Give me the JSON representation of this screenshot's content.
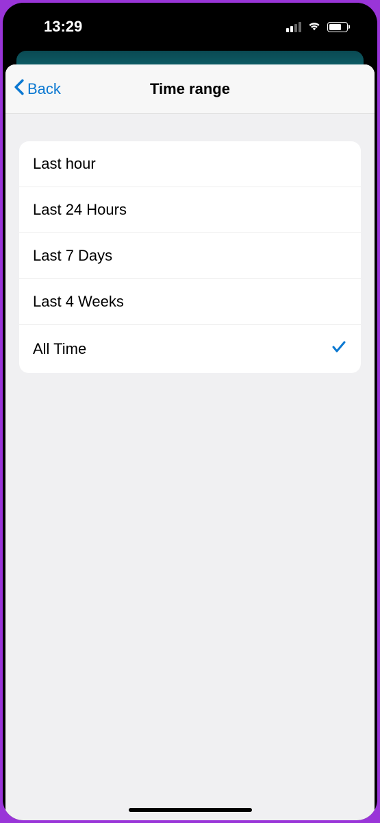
{
  "statusBar": {
    "time": "13:29"
  },
  "nav": {
    "backLabel": "Back",
    "title": "Time range"
  },
  "options": [
    {
      "label": "Last hour",
      "selected": false
    },
    {
      "label": "Last 24 Hours",
      "selected": false
    },
    {
      "label": "Last 7 Days",
      "selected": false
    },
    {
      "label": "Last 4 Weeks",
      "selected": false
    },
    {
      "label": "All Time",
      "selected": true
    }
  ]
}
